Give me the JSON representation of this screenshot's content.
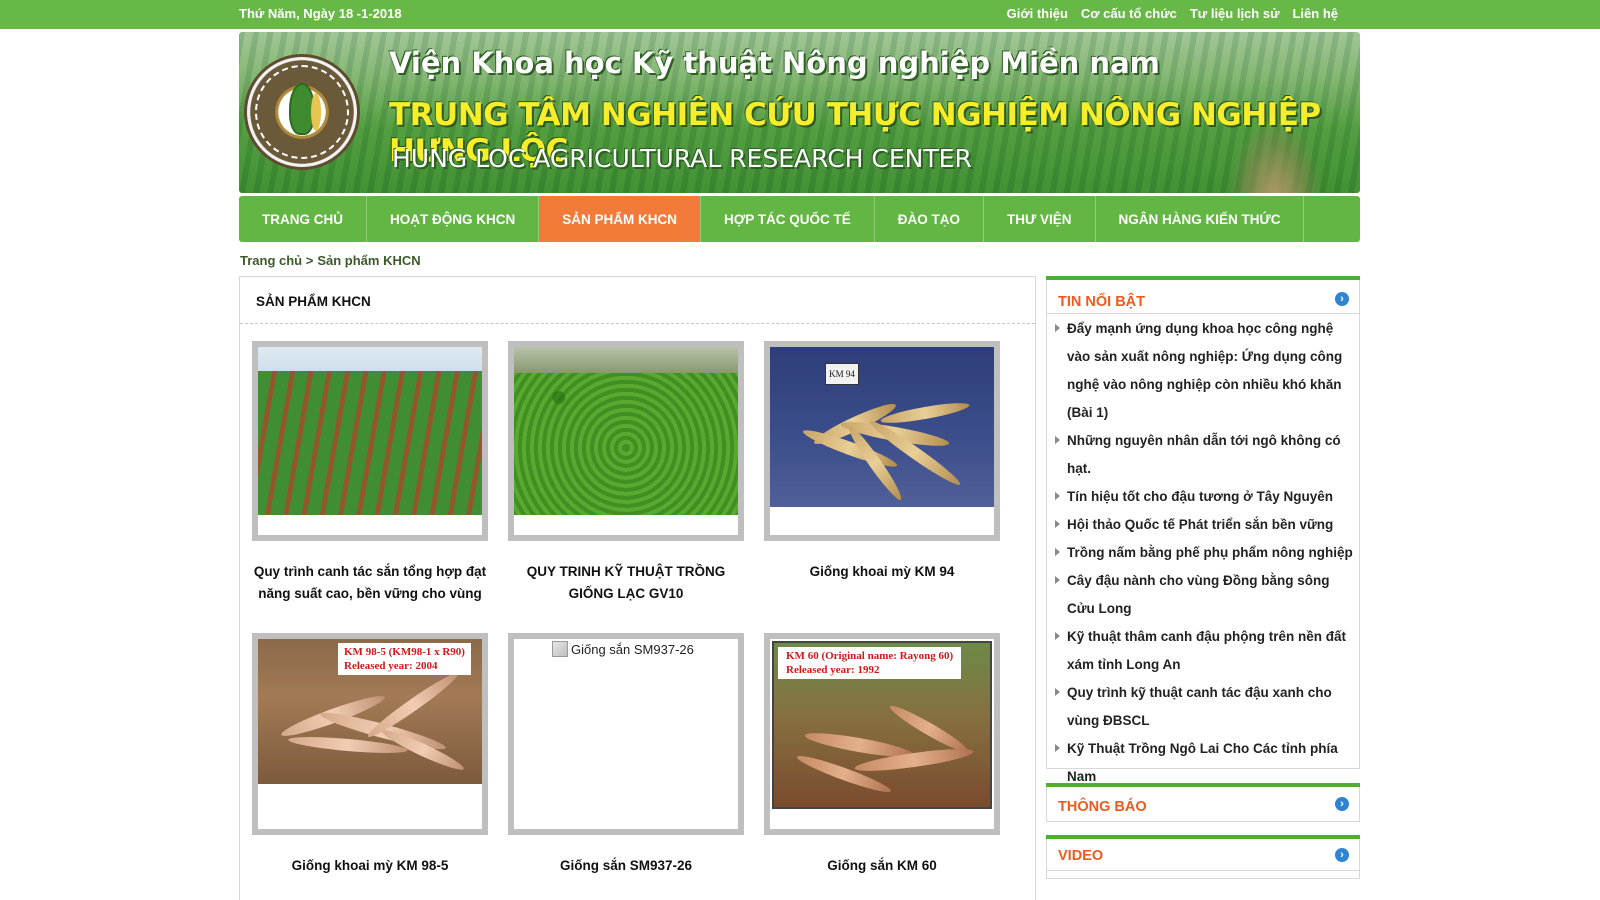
{
  "topbar": {
    "date": "Thứ Năm, Ngày 18 -1-2018",
    "links": [
      "Giới thiệu",
      "Cơ cấu tổ chức",
      "Tư liệu lịch sử",
      "Liên hệ"
    ]
  },
  "banner": {
    "line1": "Viện Khoa học Kỹ thuật Nông nghiệp Miền nam",
    "line2": "TRUNG TÂM NGHIÊN CỨU THỰC NGHIỆM NÔNG NGHIỆP HƯNG LỘC",
    "line3": "HUNG LOC AGRICULTURAL RESEARCH CENTER",
    "logo_icon": "circular-seal-logo"
  },
  "nav": {
    "items": [
      "TRANG CHỦ",
      "HOẠT ĐỘNG KHCN",
      "SẢN PHẨM KHCN",
      "HỢP TÁC QUỐC TẾ",
      "ĐÀO TẠO",
      "THƯ VIỆN",
      "NGÂN HÀNG KIẾN THỨC"
    ],
    "active_index": 2,
    "colors": {
      "bar": "#63b644",
      "active": "#f37b3a"
    }
  },
  "breadcrumb": {
    "home": "Trang chủ",
    "separator": ">",
    "current": "Sản phẩm KHCN"
  },
  "main": {
    "heading": "SẢN PHẨM KHCN",
    "products": [
      {
        "caption": "Quy trình canh tác sắn tổng hợp đạt năng suất cao, bền vững cho vùng"
      },
      {
        "caption": "QUY TRINH KỸ THUẬT TRỒNG GIỐNG LẠC GV10"
      },
      {
        "caption": "Giống khoai mỳ KM 94",
        "image_label": "KM 94"
      },
      {
        "caption": "Giống khoai mỳ KM 98-5",
        "image_label_1": "KM 98-5 (KM98-1 x R90)",
        "image_label_2": "Released year: 2004"
      },
      {
        "caption": "Giống sắn SM937-26",
        "broken_alt": "Giống sắn SM937-26"
      },
      {
        "caption": "Giống sắn KM 60",
        "image_label_1": "KM 60 (Original name: Rayong 60)",
        "image_label_2": "Released year: 1992"
      }
    ]
  },
  "sidebar": {
    "featured_title": "TIN NỔI BẬT",
    "featured_items": [
      "Đẩy mạnh ứng dụng khoa học công nghệ vào sản xuất nông nghiệp: Ứng dụng công nghệ vào nông nghiệp còn nhiều khó khăn (Bài 1)",
      "Những nguyên nhân dẫn tới ngô không có hạt.",
      "Tín hiệu tốt cho đậu tương ở Tây Nguyên",
      "Hội thảo Quốc tế Phát triển sắn bền vững",
      "Trồng nấm bằng phế phụ phẩm nông nghiệp",
      "Cây đậu nành cho vùng Đồng bằng sông Cửu Long",
      "Kỹ thuật thâm canh đậu phộng trên nền đất xám tỉnh Long An",
      "Quy trình kỹ thuật canh tác đậu xanh cho vùng ĐBSCL",
      "Kỹ Thuật Trồng Ngô Lai Cho Các tỉnh phía Nam"
    ],
    "notice_title": "THÔNG BÁO",
    "video_title": "VIDEO",
    "accent": "#f05a1e"
  }
}
